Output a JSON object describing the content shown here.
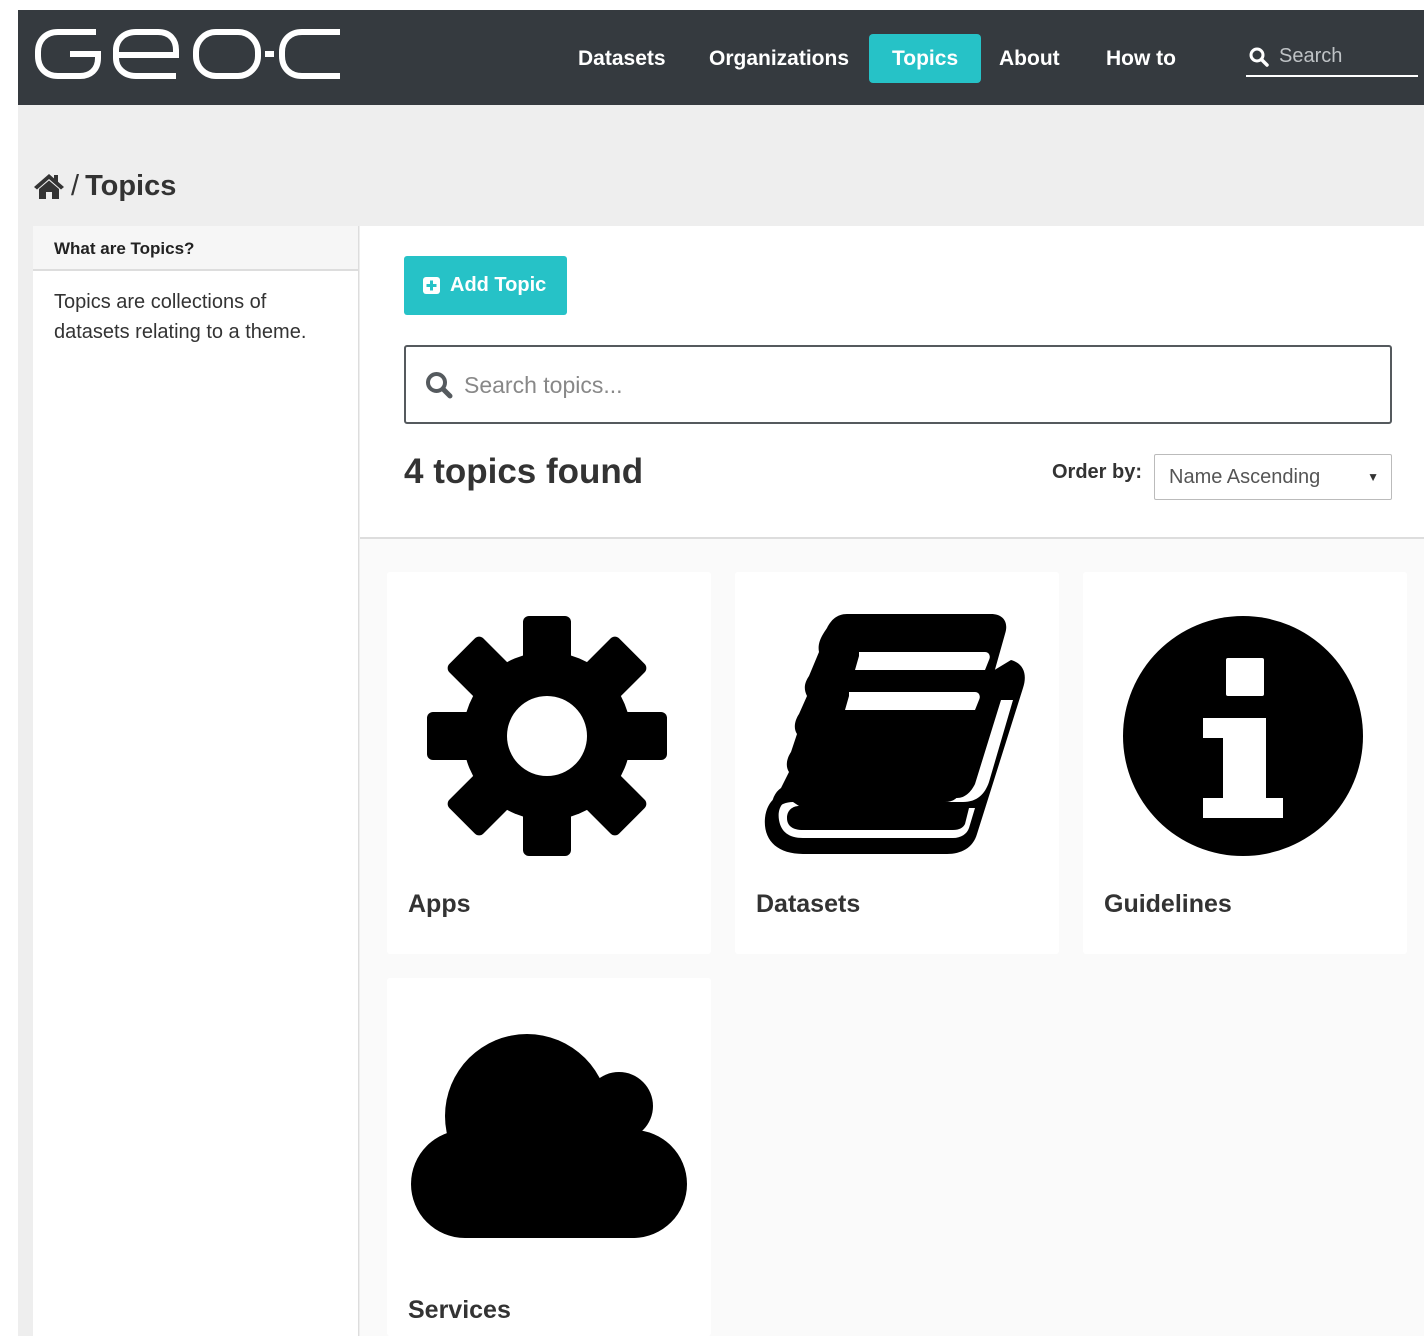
{
  "header": {
    "logo_text": "Geo-C",
    "nav": [
      {
        "label": "Datasets"
      },
      {
        "label": "Organizations"
      },
      {
        "label": "Topics",
        "active": true
      },
      {
        "label": "About"
      },
      {
        "label": "How to"
      }
    ],
    "search_placeholder": "Search"
  },
  "breadcrumb": {
    "separator": "/",
    "current": "Topics"
  },
  "sidebar": {
    "heading": "What are Topics?",
    "text": "Topics are collections of datasets relating to a theme."
  },
  "main": {
    "add_button_label": "Add Topic",
    "search_placeholder": "Search topics...",
    "count_text": "4 topics found",
    "order_label": "Order by:",
    "order_value": "Name Ascending",
    "topics": [
      {
        "title": "Apps",
        "icon": "gear-icon"
      },
      {
        "title": "Datasets",
        "icon": "book-icon"
      },
      {
        "title": "Guidelines",
        "icon": "info-icon"
      },
      {
        "title": "Services",
        "icon": "cloud-icon"
      }
    ]
  },
  "colors": {
    "navbar": "#353a3f",
    "accent": "#26c2c7"
  }
}
